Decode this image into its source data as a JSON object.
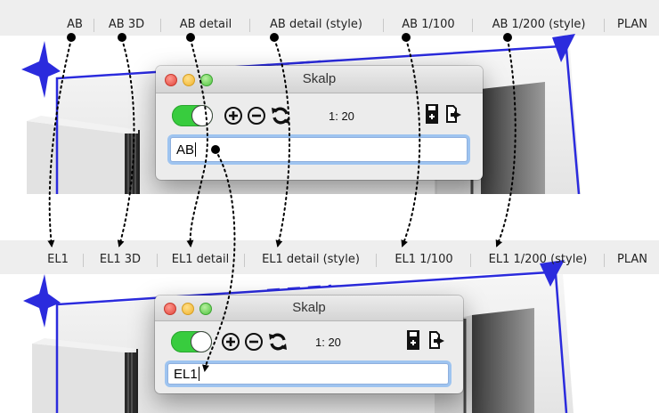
{
  "top": {
    "tabs": [
      "AB",
      "AB 3D",
      "AB detail",
      "AB detail (style)",
      "AB 1/100",
      "AB 1/200 (style)",
      "PLAN"
    ],
    "dialog": {
      "title": "Skalp",
      "scale": "1: 20",
      "input_value": "AB"
    }
  },
  "bottom": {
    "tabs": [
      "EL1",
      "EL1 3D",
      "EL1 detail",
      "EL1 detail (style)",
      "EL1 1/100",
      "EL1 1/200 (style)",
      "PLAN"
    ],
    "dialog": {
      "title": "Skalp",
      "scale": "1: 20",
      "input_value": "EL1"
    }
  },
  "colors": {
    "model_edge": "#2b2bdd",
    "toggle_on": "#38cc3e",
    "focus_ring": "#9ec4f0"
  },
  "icons": {
    "toggle": "toggle-switch-on",
    "add": "plus-circle-icon",
    "remove": "minus-circle-icon",
    "refresh": "refresh-icon",
    "save": "save-section-icon",
    "export": "export-document-icon"
  }
}
